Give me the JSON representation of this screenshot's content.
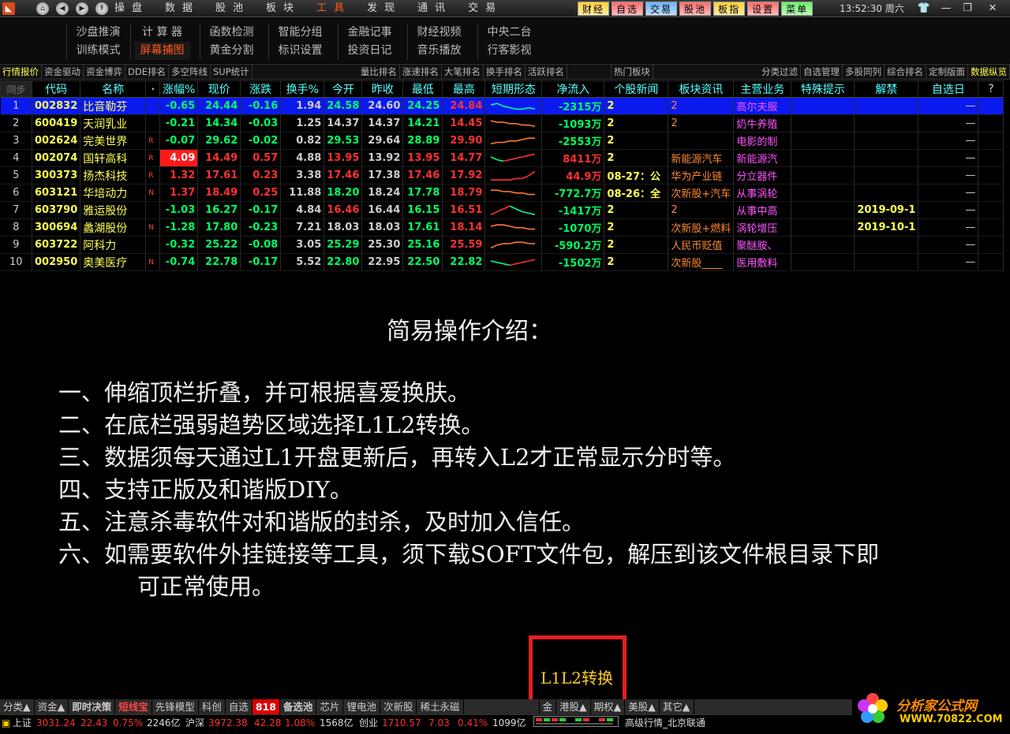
{
  "topbar": {
    "logo_icon": "app-logo-icon",
    "menu": [
      "操盘",
      "数据",
      "股池",
      "板块",
      "工具",
      "发现",
      "通讯",
      "交易"
    ],
    "active_menu": "工具",
    "right_buttons": [
      {
        "label": "财经",
        "bg": "#ffd23a"
      },
      {
        "label": "自选",
        "bg": "#ff6b6b"
      },
      {
        "label": "交易",
        "bg": "#6cb4ff"
      },
      {
        "label": "股池",
        "bg": "#ff6b6b"
      },
      {
        "label": "板指",
        "bg": "#ffd23a"
      },
      {
        "label": "设置",
        "bg": "#ff6b6b"
      },
      {
        "label": "菜单",
        "bg": "#6cf06c"
      }
    ],
    "clock": "13:52:30 周六"
  },
  "subtools": [
    [
      "沙盘推演",
      "训练模式"
    ],
    [
      "计 算 器",
      "屏幕捕图"
    ],
    [
      "函数检测",
      "黄金分割"
    ],
    [
      "智能分组",
      "标识设置"
    ],
    [
      "金融记事",
      "投资日记"
    ],
    [
      "财经视频",
      "音乐播放"
    ],
    [
      "中央二台",
      "行客影视"
    ]
  ],
  "tabs_left": [
    "行情报价",
    "资金驱动",
    "资金博弈",
    "DDE排名",
    "多空阵线",
    "SUP统计"
  ],
  "tabs_mid": [
    "量比排名",
    "涨速排名",
    "大笔排名",
    "换手排名",
    "活跃排名",
    "",
    "热门板块"
  ],
  "tabs_right": [
    "分类过滤",
    "自选管理",
    "多股同列",
    "综合排名",
    "定制版面",
    "数据纵览"
  ],
  "table": {
    "corner": "同步",
    "headers": [
      "代码",
      "名称",
      "",
      "涨幅%",
      "现价",
      "涨跌",
      "换手%",
      "今开",
      "昨收",
      "最低",
      "最高",
      "短期形态",
      "净流入",
      "个股新闻",
      "板块资讯",
      "主营业务",
      "特殊提示",
      "解禁",
      "自选日",
      "?"
    ],
    "rows": [
      {
        "idx": "1",
        "code": "002832",
        "name": "比音勒芬",
        "tag": "·",
        "pct": "-0.65",
        "price": "24.44",
        "chg": "-0.16",
        "turn": "1.94",
        "open": "24.58",
        "prev": "24.60",
        "low": "24.25",
        "high": "24.84",
        "flow": "-2315万",
        "news": "2",
        "sector": "2",
        "biz": "高尔夫服",
        "tip": "",
        "unlock": "",
        "fav": "—",
        "trend": [
          5,
          6,
          4,
          3,
          2,
          2,
          3,
          2
        ],
        "dir": "dn",
        "sel": true,
        "colors": {
          "pct": "dn",
          "price": "dn",
          "chg": "dn",
          "open": "dn",
          "low": "dn",
          "high": "up"
        }
      },
      {
        "idx": "2",
        "code": "600419",
        "name": "天润乳业",
        "tag": "",
        "pct": "-0.21",
        "price": "14.34",
        "chg": "-0.03",
        "turn": "1.25",
        "open": "14.37",
        "prev": "14.37",
        "low": "14.21",
        "high": "14.45",
        "flow": "-1093万",
        "news": "2",
        "sector": "2",
        "biz": "奶牛养殖",
        "tip": "",
        "unlock": "",
        "fav": "—",
        "trend": [
          6,
          5,
          5,
          4,
          4,
          3,
          3,
          2
        ],
        "dir": "up",
        "colors": {
          "pct": "dn",
          "price": "dn",
          "chg": "dn",
          "open": "fl",
          "low": "dn",
          "high": "up"
        }
      },
      {
        "idx": "3",
        "code": "002624",
        "name": "完美世界",
        "tag": "R",
        "pct": "-0.07",
        "price": "29.62",
        "chg": "-0.02",
        "turn": "0.82",
        "open": "29.53",
        "prev": "29.64",
        "low": "28.89",
        "high": "29.90",
        "flow": "-2553万",
        "news": "2",
        "sector": "",
        "biz": "电影的制",
        "tip": "",
        "unlock": "",
        "fav": "—",
        "trend": [
          2,
          3,
          3,
          4,
          4,
          5,
          6,
          6
        ],
        "dir": "up",
        "colors": {
          "pct": "dn",
          "price": "dn",
          "chg": "dn",
          "open": "dn",
          "low": "dn",
          "high": "up"
        }
      },
      {
        "idx": "4",
        "code": "002074",
        "name": "国轩高科",
        "tag": "R",
        "pct": "4.09",
        "price": "14.49",
        "chg": "0.57",
        "turn": "4.88",
        "open": "13.95",
        "prev": "13.92",
        "low": "13.95",
        "high": "14.77",
        "flow": "8411万",
        "news": "2",
        "sector": "新能源汽车",
        "biz": "新能源汽",
        "tip": "",
        "unlock": "",
        "fav": "—",
        "trend": [
          5,
          3,
          2,
          3,
          4,
          5,
          6,
          7
        ],
        "dir": "mix",
        "hi": true,
        "colors": {
          "pct": "up",
          "price": "up",
          "chg": "up",
          "open": "up",
          "low": "up",
          "high": "up"
        }
      },
      {
        "idx": "5",
        "code": "300373",
        "name": "扬杰科技",
        "tag": "R",
        "pct": "1.32",
        "price": "17.61",
        "chg": "0.23",
        "turn": "3.38",
        "open": "17.46",
        "prev": "17.38",
        "low": "17.46",
        "high": "17.92",
        "flow": "44.9万",
        "news": "08-27：公",
        "sector": "华为产业链",
        "biz": "分立器件",
        "tip": "",
        "unlock": "",
        "fav": "—",
        "trend": [
          1,
          1,
          1,
          1,
          2,
          2,
          4,
          7
        ],
        "dir": "mix",
        "colors": {
          "pct": "up",
          "price": "up",
          "chg": "up",
          "open": "up",
          "low": "up",
          "high": "up"
        }
      },
      {
        "idx": "6",
        "code": "603121",
        "name": "华培动力",
        "tag": "N",
        "pct": "1.37",
        "price": "18.49",
        "chg": "0.25",
        "turn": "11.88",
        "open": "18.20",
        "prev": "18.24",
        "low": "17.78",
        "high": "18.79",
        "flow": "-772.7万",
        "news": "08-26：全",
        "sector": "次新股+汽车",
        "biz": "从事涡轮",
        "tip": "",
        "unlock": "",
        "fav": "—",
        "trend": [
          6,
          6,
          5,
          5,
          4,
          4,
          3,
          3
        ],
        "dir": "up",
        "colors": {
          "pct": "up",
          "price": "up",
          "chg": "up",
          "open": "dn",
          "low": "dn",
          "high": "up"
        }
      },
      {
        "idx": "7",
        "code": "603790",
        "name": "雅运股份",
        "tag": "",
        "pct": "-1.03",
        "price": "16.27",
        "chg": "-0.17",
        "turn": "4.84",
        "open": "16.46",
        "prev": "16.44",
        "low": "16.15",
        "high": "16.51",
        "flow": "-1417万",
        "news": "2",
        "sector": "2",
        "biz": "从事中高",
        "tip": "",
        "unlock": "2019-09-1",
        "fav": "—",
        "trend": [
          1,
          3,
          5,
          7,
          5,
          3,
          2,
          1
        ],
        "dir": "mix",
        "colors": {
          "pct": "dn",
          "price": "dn",
          "chg": "dn",
          "open": "up",
          "low": "dn",
          "high": "up"
        }
      },
      {
        "idx": "8",
        "code": "300694",
        "name": "蠡湖股份",
        "tag": "N",
        "pct": "-1.28",
        "price": "17.80",
        "chg": "-0.23",
        "turn": "7.21",
        "open": "18.03",
        "prev": "18.03",
        "low": "17.61",
        "high": "18.14",
        "flow": "-1070万",
        "news": "2",
        "sector": "次新股+燃料",
        "biz": "涡轮增压",
        "tip": "",
        "unlock": "2019-10-1",
        "fav": "—",
        "trend": [
          5,
          6,
          6,
          5,
          4,
          4,
          3,
          3
        ],
        "dir": "up",
        "colors": {
          "pct": "dn",
          "price": "dn",
          "chg": "dn",
          "open": "fl",
          "low": "dn",
          "high": "up"
        }
      },
      {
        "idx": "9",
        "code": "603722",
        "name": "阿科力",
        "tag": "",
        "pct": "-0.32",
        "price": "25.22",
        "chg": "-0.08",
        "turn": "3.05",
        "open": "25.29",
        "prev": "25.30",
        "low": "25.16",
        "high": "25.59",
        "flow": "-590.2万",
        "news": "2",
        "sector": "人民币贬值",
        "biz": "聚醚胺、",
        "tip": "",
        "unlock": "",
        "fav": "—",
        "trend": [
          2,
          4,
          5,
          5,
          6,
          6,
          5,
          5
        ],
        "dir": "up",
        "colors": {
          "pct": "dn",
          "price": "dn",
          "chg": "dn",
          "open": "dn",
          "low": "dn",
          "high": "up"
        }
      },
      {
        "idx": "10",
        "code": "002950",
        "name": "奥美医疗",
        "tag": "N",
        "pct": "-0.74",
        "price": "22.78",
        "chg": "-0.17",
        "turn": "5.52",
        "open": "22.80",
        "prev": "22.95",
        "low": "22.50",
        "high": "22.82",
        "flow": "-1502万",
        "news": "2",
        "sector": "次新股____",
        "biz": "医用敷料",
        "tip": "",
        "unlock": "",
        "fav": "—",
        "trend": [
          5,
          4,
          3,
          2,
          3,
          4,
          5,
          6
        ],
        "dir": "mix",
        "colors": {
          "pct": "dn",
          "price": "dn",
          "chg": "dn",
          "open": "dn",
          "low": "dn",
          "high": "dn"
        }
      }
    ]
  },
  "intro": {
    "title": "简易操作介绍：",
    "lines": [
      "一、伸缩顶栏折叠，并可根据喜爱换肤。",
      "二、在底栏强弱趋势区域选择L1L2转换。",
      "三、数据须每天通过L1开盘更新后，再转入L2才正常显示分时等。",
      "四、支持正版及和谐版DIY。",
      "五、注意杀毒软件对和谐版的封杀，及时加入信任。",
      "六、如需要软件外挂链接等工具，须下载SOFT文件包，解压到该文件根目录下即",
      "可正常使用。"
    ]
  },
  "l1l2_label": "L1L2转换",
  "bottom_tabs": [
    {
      "label": "分类▲",
      "style": ""
    },
    {
      "label": "资金▲",
      "style": ""
    },
    {
      "label": "即时决策",
      "style": "bold"
    },
    {
      "label": "短线宝",
      "style": "hot"
    },
    {
      "label": "先锋模型",
      "style": ""
    },
    {
      "label": "科创",
      "style": ""
    },
    {
      "label": "自选",
      "style": ""
    },
    {
      "label": "818",
      "style": "badge"
    },
    {
      "label": "备选池",
      "style": "bold"
    },
    {
      "label": "芯片",
      "style": ""
    },
    {
      "label": "锂电池",
      "style": ""
    },
    {
      "label": "次新股",
      "style": ""
    },
    {
      "label": "稀土永磁",
      "style": ""
    },
    {
      "label": "",
      "style": ""
    },
    {
      "label": "金",
      "style": ""
    },
    {
      "label": "港股▲",
      "style": ""
    },
    {
      "label": "期权▲",
      "style": ""
    },
    {
      "label": "美股▲",
      "style": ""
    },
    {
      "label": "其它▲",
      "style": ""
    }
  ],
  "status": {
    "sh_label": "上证",
    "sh_val": "3031.24",
    "sh_chg": "22.43",
    "sh_pct": "0.75%",
    "sh_amt": "2246亿",
    "sz_label": "沪深",
    "sz_val": "3972.38",
    "sz_chg": "42.28",
    "sz_pct": "1.08%",
    "sz_amt": "1568亿",
    "cy_label": "创业",
    "cy_val": "1710.57",
    "cy_chg": "7.03",
    "cy_pct": "0.41%",
    "cy_amt": "1099亿",
    "feed": "高级行情_北京联通"
  },
  "watermark": {
    "title": "分析家公式网",
    "url": "WWW.70822.COM"
  }
}
